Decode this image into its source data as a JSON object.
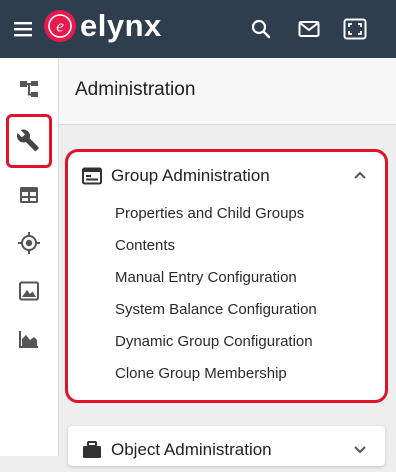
{
  "app": {
    "brand": "elynx",
    "brand_mark": "e"
  },
  "topbar": {
    "menu_icon": "hamburger-icon",
    "icons": [
      "search-icon",
      "mail-icon",
      "fullscreen-icon"
    ]
  },
  "sidenav": {
    "items": [
      {
        "icon": "hierarchy-icon",
        "active": false
      },
      {
        "icon": "wrench-icon",
        "active": true
      },
      {
        "icon": "table-icon",
        "active": false
      },
      {
        "icon": "crosshair-icon",
        "active": false
      },
      {
        "icon": "image-icon",
        "active": false
      },
      {
        "icon": "area-chart-icon",
        "active": false
      }
    ]
  },
  "page": {
    "title": "Administration"
  },
  "group_admin": {
    "title": "Group Administration",
    "links": [
      "Properties and Child Groups",
      "Contents",
      "Manual Entry Configuration",
      "System Balance Configuration",
      "Dynamic Group Configuration",
      "Clone Group Membership"
    ]
  },
  "object_admin": {
    "title": "Object Administration"
  },
  "colors": {
    "topbar": "#2f3e4e",
    "brand": "#e8194c",
    "highlight": "#e0132a"
  }
}
